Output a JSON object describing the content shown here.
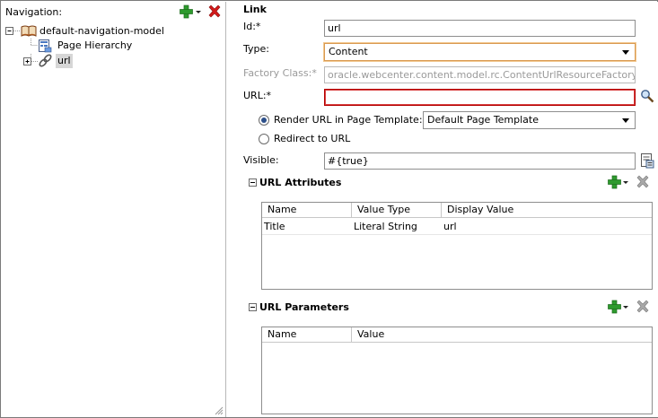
{
  "navigation": {
    "title": "Navigation:",
    "tree": [
      {
        "label": "default-navigation-model",
        "level": 0
      },
      {
        "label": "Page Hierarchy",
        "level": 1
      },
      {
        "label": "url",
        "level": 1
      }
    ]
  },
  "link": {
    "section_title": "Link",
    "id_label": "Id:*",
    "id_value": "url",
    "type_label": "Type:",
    "type_value": "Content",
    "factory_label": "Factory Class:*",
    "factory_value": "oracle.webcenter.content.model.rc.ContentUrlResourceFactory",
    "url_label": "URL:*",
    "url_value": "",
    "render_option_label": "Render URL in Page Template:",
    "render_template_value": "Default Page Template",
    "redirect_option_label": "Redirect to URL",
    "visible_label": "Visible:",
    "visible_value": "#{true}"
  },
  "url_attributes": {
    "title": "URL Attributes",
    "columns": [
      "Name",
      "Value Type",
      "Display Value"
    ],
    "rows": [
      {
        "name": "Title",
        "value_type": "Literal String",
        "display_value": "url"
      }
    ]
  },
  "url_parameters": {
    "title": "URL Parameters",
    "columns": [
      "Name",
      "Value"
    ]
  },
  "colors": {
    "add_green": "#2e9a2e",
    "delete_red": "#d21a1a",
    "error_border": "#b40000",
    "focus_border": "#d99a52"
  }
}
